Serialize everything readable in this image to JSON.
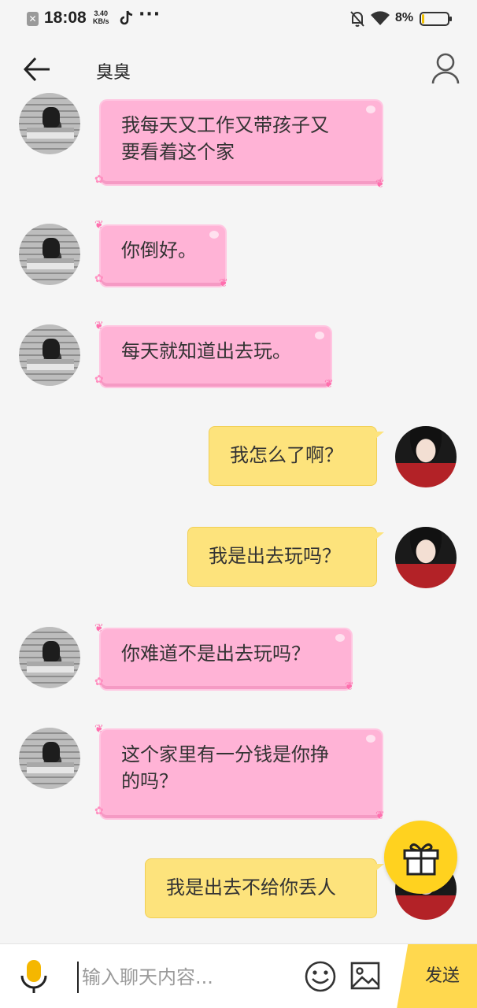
{
  "status_bar": {
    "time": "18:08",
    "speed_value": "3.40",
    "speed_unit": "KB/s",
    "battery_percent": "8%",
    "battery_level": 0.08,
    "icons": [
      "notification-x-icon",
      "tiktok-icon",
      "more-dots-icon",
      "bell-muted-icon",
      "wifi-icon",
      "battery-icon"
    ],
    "more_dots": "···"
  },
  "header": {
    "title": "臭臭",
    "back_icon": "arrow-left-icon",
    "profile_icon": "person-icon"
  },
  "messages": [
    {
      "side": "left",
      "style": "pink",
      "text_lines": [
        "我每天又工作又带孩子又",
        "要看着这个家"
      ]
    },
    {
      "side": "left",
      "style": "pink",
      "text_lines": [
        "你倒好。"
      ]
    },
    {
      "side": "left",
      "style": "pink",
      "text_lines": [
        "每天就知道出去玩。"
      ]
    },
    {
      "side": "right",
      "style": "yellow",
      "text_lines": [
        "我怎么了啊？"
      ]
    },
    {
      "side": "right",
      "style": "yellow",
      "text_lines": [
        "我是出去玩吗？"
      ]
    },
    {
      "side": "left",
      "style": "pink",
      "text_lines": [
        "你难道不是出去玩吗？"
      ]
    },
    {
      "side": "left",
      "style": "pink",
      "text_lines": [
        "这个家里有一分钱是你挣",
        "的吗？"
      ]
    },
    {
      "side": "right",
      "style": "yellow",
      "text_lines": [
        "我是出去不给你丢人"
      ]
    }
  ],
  "gift": {
    "icon": "gift-icon"
  },
  "input_bar": {
    "mic_icon": "microphone-icon",
    "placeholder": "输入聊天内容...",
    "value": "",
    "emoji_icon": "smiley-icon",
    "image_icon": "image-icon",
    "send_label": "发送"
  },
  "colors": {
    "pink_bubble": "#ffb3d6",
    "yellow_bubble": "#fde37c",
    "accent_yellow": "#ffd21f",
    "background": "#f5f5f5"
  }
}
